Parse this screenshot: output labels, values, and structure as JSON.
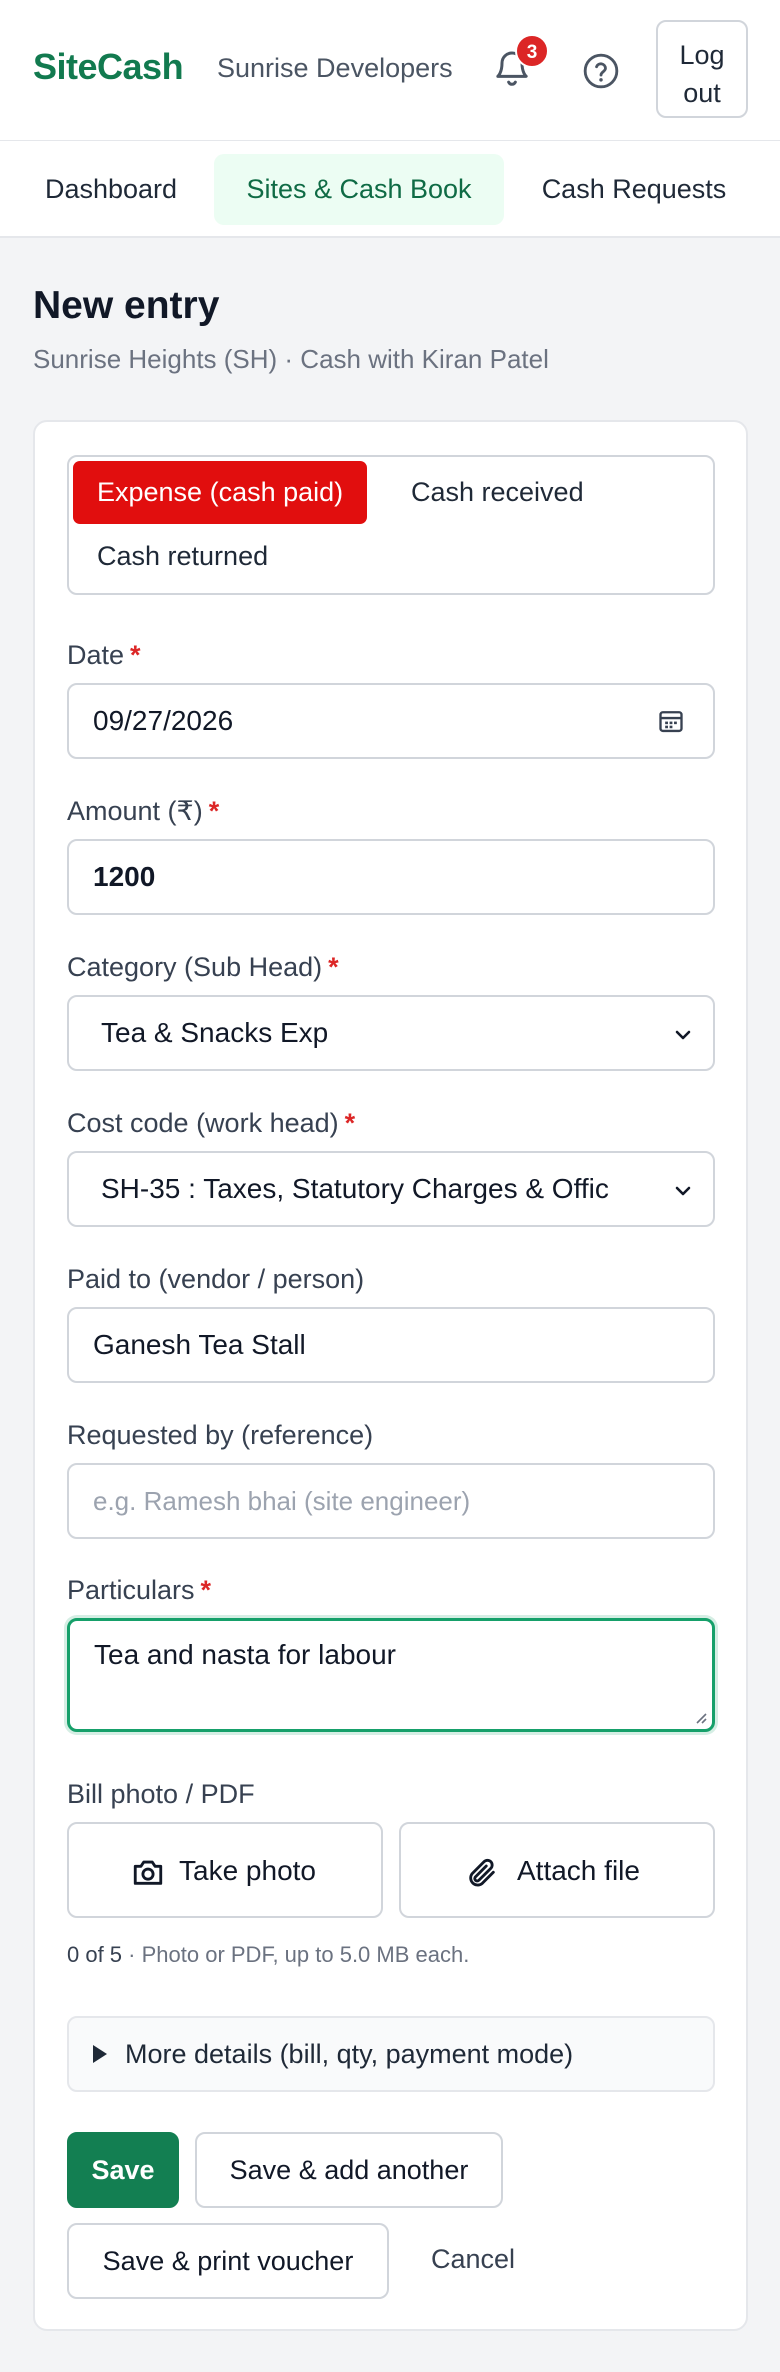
{
  "header": {
    "brand": "SiteCash",
    "organization": "Sunrise Developers",
    "notification_count": "3",
    "logout_label": "Log out",
    "icons": {
      "notifications": "bell-icon",
      "help": "help-icon"
    },
    "colors": {
      "brand": "#127a4f",
      "badge": "#dc2626"
    }
  },
  "nav": {
    "tabs": [
      {
        "label": "Dashboard",
        "active": false
      },
      {
        "label": "Sites & Cash Book",
        "active": true
      },
      {
        "label": "Cash Requests",
        "active": false
      }
    ]
  },
  "page": {
    "title": "New entry",
    "subtitle": "Sunrise Heights (SH) · Cash with Kiran Patel"
  },
  "form": {
    "entry_types": [
      {
        "label": "Expense (cash paid)",
        "selected": true
      },
      {
        "label": "Cash received",
        "selected": false
      },
      {
        "label": "Cash returned",
        "selected": false
      }
    ],
    "date": {
      "label": "Date",
      "required_mark": "*",
      "value": "09/27/2026",
      "icon": "calendar-icon"
    },
    "amount": {
      "label": "Amount (₹)",
      "required_mark": "*",
      "value": "1200"
    },
    "category": {
      "label": "Category (Sub Head)",
      "required_mark": "*",
      "value": "Tea & Snacks Exp"
    },
    "cost_code": {
      "label": "Cost code (work head)",
      "required_mark": "*",
      "value": "SH-35 : Taxes, Statutory Charges & Offic"
    },
    "paid_to": {
      "label": "Paid to (vendor / person)",
      "value": "Ganesh Tea Stall"
    },
    "requested_by": {
      "label": "Requested by (reference)",
      "placeholder": "e.g. Ramesh bhai (site engineer)"
    },
    "particulars": {
      "label": "Particulars",
      "required_mark": "*",
      "value": "Tea and nasta for labour"
    },
    "attachments": {
      "label": "Bill photo / PDF",
      "take_photo_label": "Take photo",
      "attach_file_label": "Attach file",
      "count_text": "0 of 5",
      "hint_text": " · Photo or PDF, up to 5.0 MB each."
    },
    "more_details_label": "More details (bill, qty, payment mode)",
    "actions": {
      "save": "Save",
      "save_add_another": "Save & add another",
      "save_print": "Save & print voucher",
      "cancel": "Cancel"
    },
    "colors": {
      "expense_selected": "#e10e0e",
      "primary_button": "#137f52",
      "focus_border": "#16a06a"
    }
  }
}
